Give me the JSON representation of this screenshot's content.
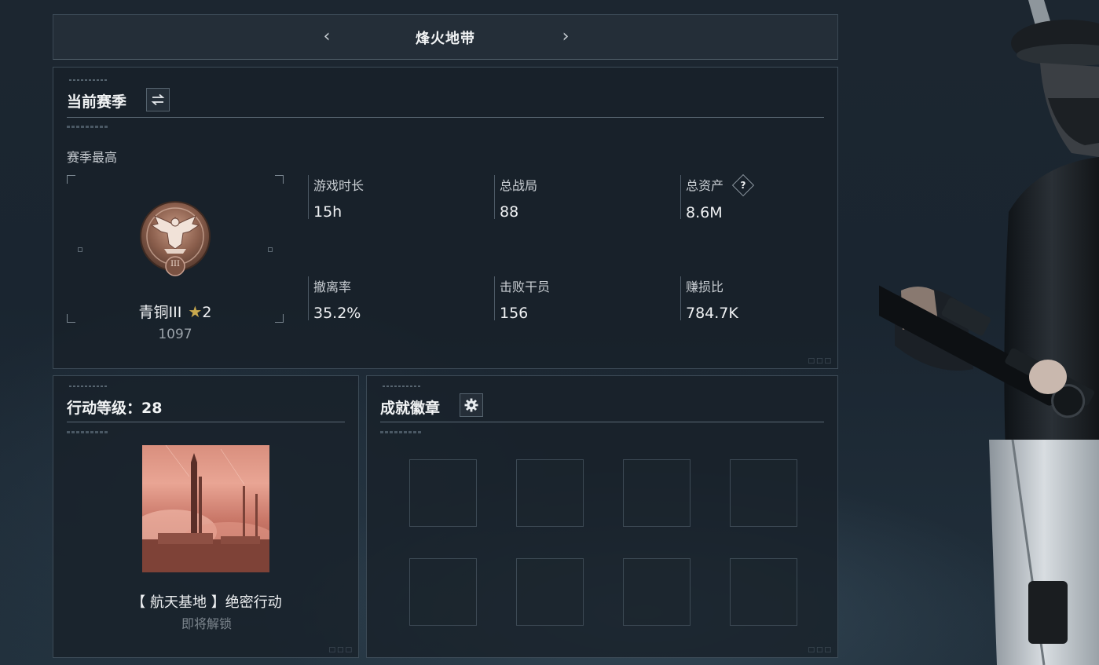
{
  "header": {
    "title": "烽火地带"
  },
  "season": {
    "section_title": "当前赛季",
    "best_label": "赛季最高",
    "rank_name": "青铜III",
    "rank_stars": "2",
    "rank_points": "1097",
    "rank_emblem_numeral": "III",
    "stats": [
      {
        "label": "游戏时长",
        "value": "15h"
      },
      {
        "label": "总战局",
        "value": "88"
      },
      {
        "label": "总资产",
        "value": "8.6M"
      },
      {
        "label": "撤离率",
        "value": "35.2%"
      },
      {
        "label": "击败干员",
        "value": "156"
      },
      {
        "label": "赚损比",
        "value": "784.7K"
      }
    ],
    "help_icon": "?"
  },
  "operation": {
    "section_title": "行动等级：28",
    "mission_name": "【 航天基地 】绝密行动",
    "mission_status": "即将解锁"
  },
  "achievements": {
    "section_title": "成就徽章",
    "slot_count": 8
  },
  "colors": {
    "panel_bg": "#18212a",
    "border": "#3c4a56",
    "text": "#e6e8ea",
    "muted": "#8a939b",
    "bronze": "#9a6b55"
  }
}
